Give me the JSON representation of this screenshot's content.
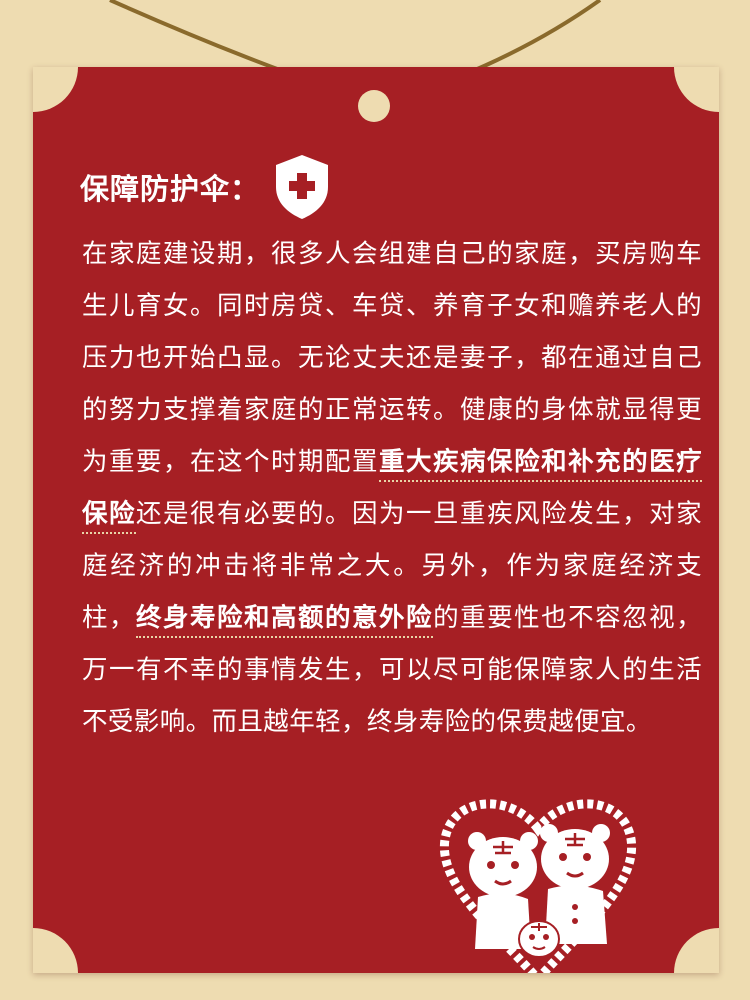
{
  "card": {
    "heading": "保障防护伞：",
    "shield_icon": "shield-medical-cross",
    "paragraph": {
      "p1": "在家庭建设期，很多人会组建自己的家庭，买房购车生儿育女。同时房贷、车贷、养育子女和赡养老人的压力也开始凸显。无论丈夫还是妻子，都在通过自己的努力支撑着家庭的正常运转。健康的身体就显得更为重要，在这个时期配置",
      "h1": "重大疾病保险和补充的医疗保险",
      "p2": "还是很有必要的。因为一旦重疾风险发生，对家庭经济的冲击将非常之大。另外，作为家庭经济支柱，",
      "h2": "终身寿险和高额的意外险",
      "p3": "的重要性也不容忽视，万一有不幸的事情发生，可以尽可能保障家人的生活不受影响。而且越年轻，终身寿险的保费越便宜。"
    }
  },
  "colors": {
    "background": "#eedcb1",
    "card": "#a61f24",
    "text": "#ffffff",
    "string": "#8a6a2c"
  }
}
